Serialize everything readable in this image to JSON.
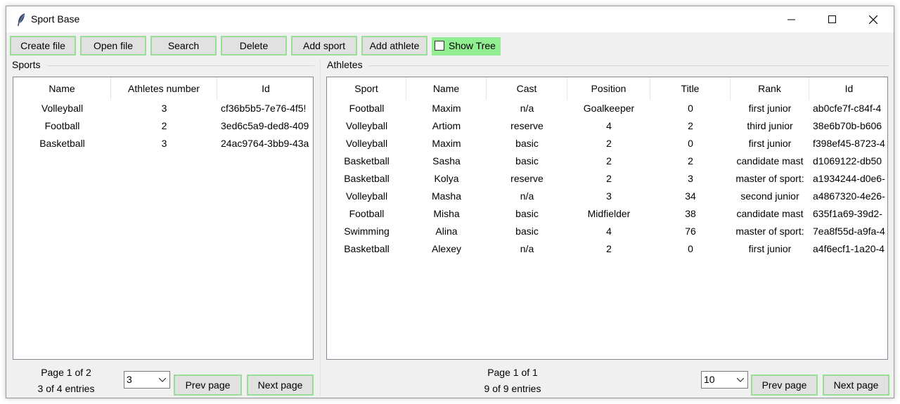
{
  "window": {
    "title": "Sport Base"
  },
  "toolbar": {
    "create_file": "Create file",
    "open_file": "Open file",
    "search": "Search",
    "delete": "Delete",
    "add_sport": "Add sport",
    "add_athlete": "Add athlete",
    "show_tree": "Show Tree",
    "show_tree_checked": false
  },
  "sports": {
    "label": "Sports",
    "columns": [
      "Name",
      "Athletes number",
      "Id"
    ],
    "rows": [
      [
        "Volleyball",
        "3",
        "cf36b5b5-7e76-4f5!"
      ],
      [
        "Football",
        "2",
        "3ed6c5a9-ded8-409"
      ],
      [
        "Basketball",
        "3",
        "24ac9764-3bb9-43a"
      ]
    ],
    "pager": {
      "page_text": "Page 1 of 2",
      "entries_text": "3 of 4 entries",
      "per_page": "3",
      "prev": "Prev page",
      "next": "Next page"
    }
  },
  "athletes": {
    "label": "Athletes",
    "columns": [
      "Sport",
      "Name",
      "Cast",
      "Position",
      "Title",
      "Rank",
      "Id"
    ],
    "rows": [
      [
        "Football",
        "Maxim",
        "n/a",
        "Goalkeeper",
        "0",
        "first junior",
        "ab0cfe7f-c84f-4"
      ],
      [
        "Volleyball",
        "Artiom",
        "reserve",
        "4",
        "2",
        "third junior",
        "38e6b70b-b606"
      ],
      [
        "Volleyball",
        "Maxim",
        "basic",
        "2",
        "0",
        "first junior",
        "f398ef45-8723-4"
      ],
      [
        "Basketball",
        "Sasha",
        "basic",
        "2",
        "2",
        "candidate mast",
        "d1069122-db50"
      ],
      [
        "Basketball",
        "Kolya",
        "reserve",
        "2",
        "3",
        "master of sport:",
        "a1934244-d0e6-"
      ],
      [
        "Volleyball",
        "Masha",
        "n/a",
        "3",
        "34",
        "second junior",
        "a4867320-4e26-"
      ],
      [
        "Football",
        "Misha",
        "basic",
        "Midfielder",
        "38",
        "candidate mast",
        "635f1a69-39d2-"
      ],
      [
        "Swimming",
        "Alina",
        "basic",
        "4",
        "76",
        "master of sport:",
        "7ea8f55d-a9fa-4"
      ],
      [
        "Basketball",
        "Alexey",
        "n/a",
        "2",
        "0",
        "first junior",
        "a4f6ecf1-1a20-4"
      ]
    ],
    "pager": {
      "page_text": "Page 1 of 1",
      "entries_text": "9 of 9 entries",
      "per_page": "10",
      "prev": "Prev page",
      "next": "Next page"
    }
  },
  "colors": {
    "button_border": "#99dd99",
    "show_tree_bg": "#90ee90",
    "window_bg": "#f0f0f0"
  },
  "icons": {
    "app": "feather-icon",
    "minimize": "minimize-icon",
    "maximize": "maximize-icon",
    "close": "close-icon"
  }
}
